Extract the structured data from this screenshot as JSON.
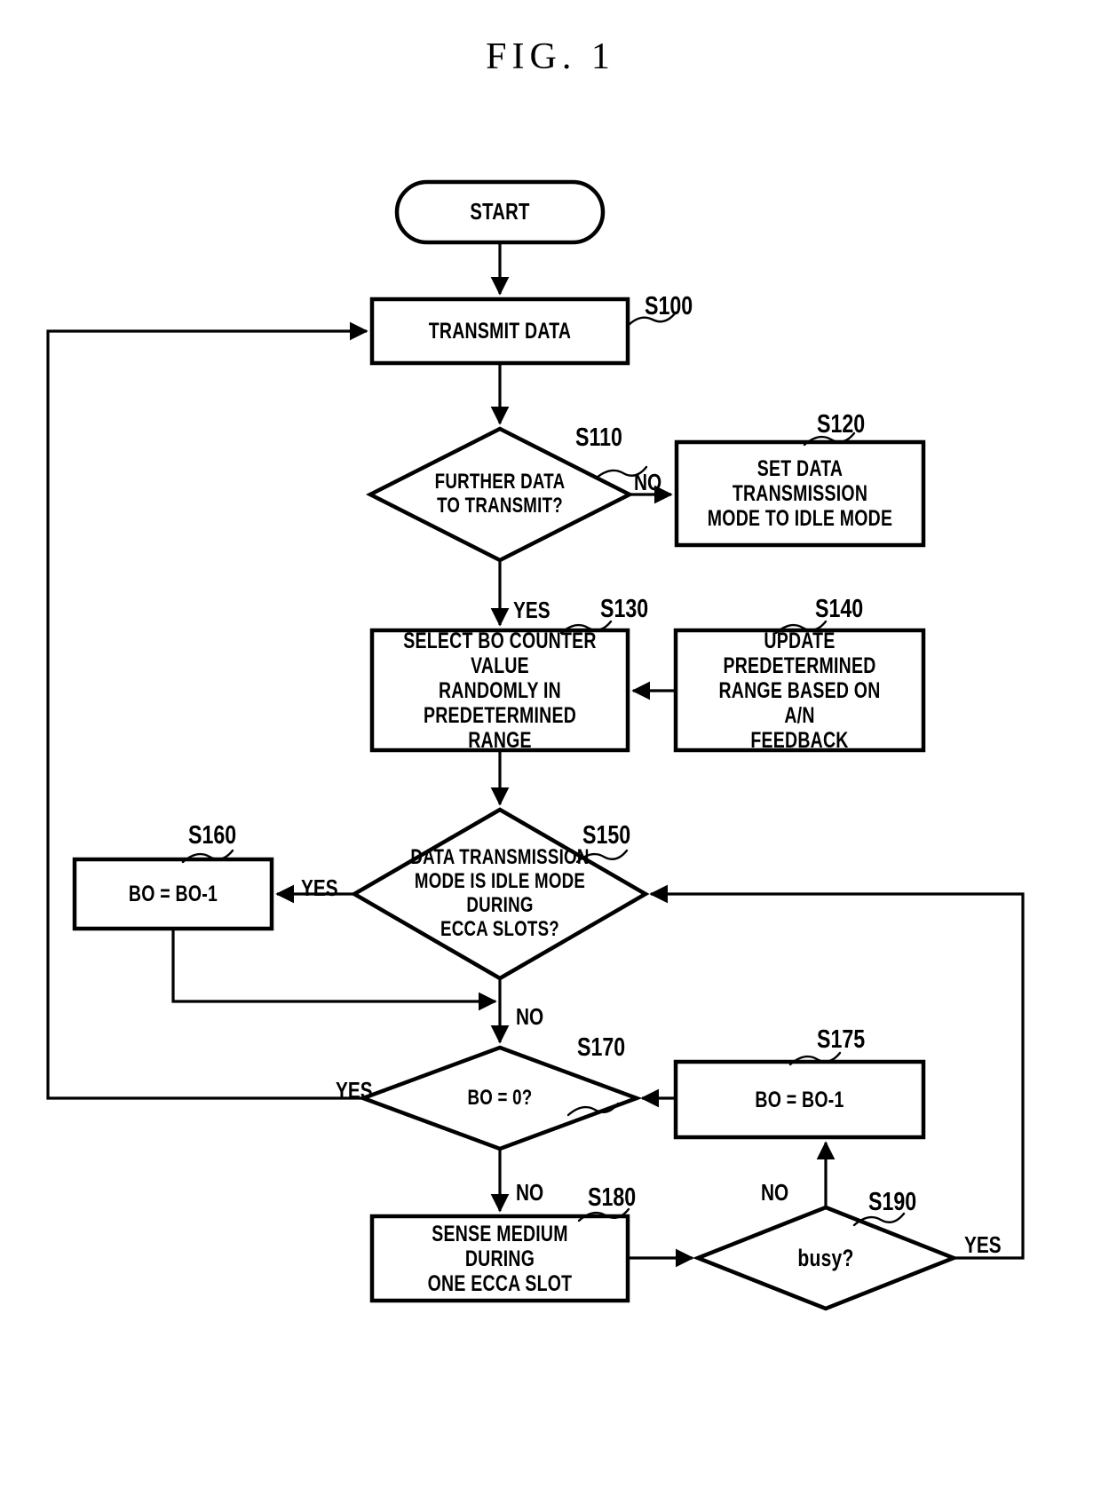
{
  "figure": {
    "title": "FIG. 1",
    "type": "patent-flowchart"
  },
  "nodes": {
    "start": {
      "label": "START",
      "ref": "",
      "shape": "terminator"
    },
    "s100": {
      "label": "TRANSMIT DATA",
      "ref": "S100",
      "shape": "process"
    },
    "s110": {
      "label": "FURTHER DATA\nTO TRANSMIT?",
      "ref": "S110",
      "shape": "decision"
    },
    "s120": {
      "label": "SET DATA TRANSMISSION\nMODE TO IDLE MODE",
      "ref": "S120",
      "shape": "process"
    },
    "s130": {
      "label": "SELECT BO COUNTER VALUE\nRANDOMLY IN\nPREDETERMINED RANGE",
      "ref": "S130",
      "shape": "process"
    },
    "s140": {
      "label": "UPDATE PREDETERMINED\nRANGE BASED ON A/N\nFEEDBACK",
      "ref": "S140",
      "shape": "process"
    },
    "s150": {
      "label": "DATA TRANSMISSION\nMODE IS IDLE MODE DURING\nECCA SLOTS?",
      "ref": "S150",
      "shape": "decision"
    },
    "s160": {
      "label": "BO = BO-1",
      "ref": "S160",
      "shape": "process"
    },
    "s170": {
      "label": "BO = 0?",
      "ref": "S170",
      "shape": "decision"
    },
    "s175": {
      "label": "BO = BO-1",
      "ref": "S175",
      "shape": "process"
    },
    "s180": {
      "label": "SENSE MEDIUM DURING\nONE ECCA SLOT",
      "ref": "S180",
      "shape": "process"
    },
    "s190": {
      "label": "busy?",
      "ref": "S190",
      "shape": "decision"
    }
  },
  "edge_labels": {
    "s110_no": "NO",
    "s110_yes": "YES",
    "s150_yes": "YES",
    "s150_no": "NO",
    "s170_yes": "YES",
    "s170_no": "NO",
    "s190_no": "NO",
    "s190_yes": "YES"
  },
  "colors": {
    "stroke": "#000000",
    "background": "#ffffff",
    "text": "#000000"
  }
}
